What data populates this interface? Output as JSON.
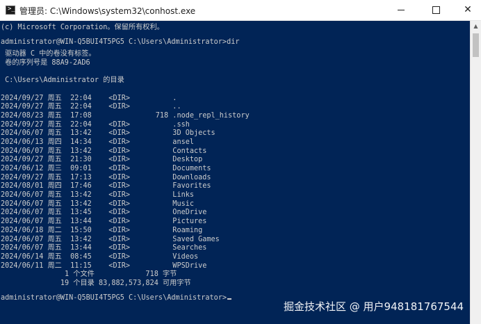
{
  "window": {
    "title": "管理员: C:\\Windows\\system32\\conhost.exe",
    "app_icon_glyph": ">_",
    "minimize": "minimize",
    "maximize": "maximize",
    "close": "✕"
  },
  "console": {
    "lines": [
      "(c) Microsoft Corporation。保留所有权利。",
      "",
      "administrator@WIN-Q5BUI4T5PG5 C:\\Users\\Administrator>dir",
      " 驱动器 C 中的卷没有标签。",
      " 卷的序列号是 88A9-2AD6",
      "",
      " C:\\Users\\Administrator 的目录",
      "",
      "2024/09/27 周五  22:04    <DIR>          .",
      "2024/09/27 周五  22:04    <DIR>          ..",
      "2024/08/23 周五  17:08               718 .node_repl_history",
      "2024/09/27 周五  22:04    <DIR>          .ssh",
      "2024/06/07 周五  13:42    <DIR>          3D Objects",
      "2024/06/13 周四  14:34    <DIR>          ansel",
      "2024/06/07 周五  13:42    <DIR>          Contacts",
      "2024/09/27 周五  21:30    <DIR>          Desktop",
      "2024/06/12 周三  09:01    <DIR>          Documents",
      "2024/09/27 周五  17:13    <DIR>          Downloads",
      "2024/08/01 周四  17:46    <DIR>          Favorites",
      "2024/06/07 周五  13:42    <DIR>          Links",
      "2024/06/07 周五  13:42    <DIR>          Music",
      "2024/06/07 周五  13:45    <DIR>          OneDrive",
      "2024/06/07 周五  13:44    <DIR>          Pictures",
      "2024/06/18 周二  15:50    <DIR>          Roaming",
      "2024/06/07 周五  13:42    <DIR>          Saved Games",
      "2024/06/07 周五  13:44    <DIR>          Searches",
      "2024/06/14 周五  08:45    <DIR>          Videos",
      "2024/06/11 周二  11:15    <DIR>          WPSDrive",
      "               1 个文件            718 字节",
      "              19 个目录 83,882,573,824 可用字节",
      "",
      "administrator@WIN-Q5BUI4T5PG5 C:\\Users\\Administrator>"
    ]
  },
  "scrollbar": {
    "up_arrow": "▲"
  },
  "watermark": "掘金技术社区 @ 用户948181767544",
  "colors": {
    "console_bg": "#012456",
    "console_fg": "#cccccc",
    "titlebar_bg": "#ffffff"
  }
}
